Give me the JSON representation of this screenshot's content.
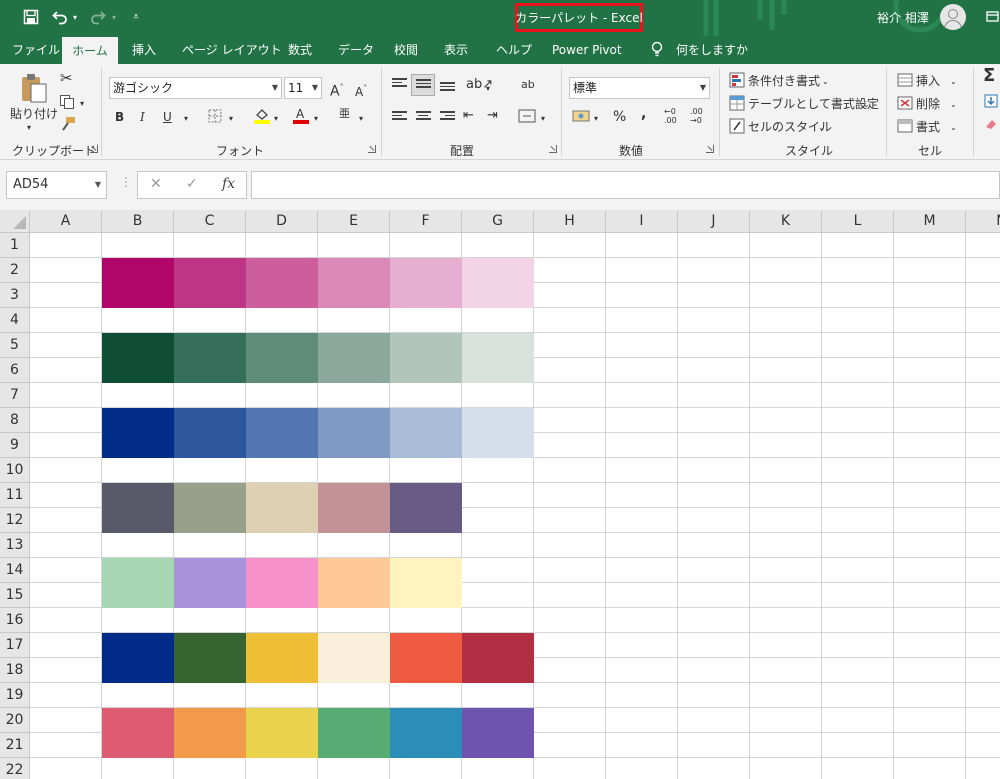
{
  "window": {
    "title": "カラーパレット  -  Excel",
    "user": "裕介 相澤"
  },
  "tabs": [
    "ファイル",
    "ホーム",
    "挿入",
    "ページ レイアウト",
    "数式",
    "データ",
    "校閲",
    "表示",
    "ヘルプ",
    "Power Pivot",
    "何をしますか"
  ],
  "active_tab": "ホーム",
  "ribbon": {
    "clipboard": {
      "paste_label": "貼り付け",
      "group_label": "クリップボード"
    },
    "font": {
      "font_name": "游ゴシック",
      "font_size": "11",
      "group_label": "フォント",
      "bold": "B",
      "italic": "I",
      "underline": "U"
    },
    "alignment": {
      "group_label": "配置"
    },
    "number": {
      "format": "標準",
      "percent": "%",
      "comma": ",",
      "group_label": "数値"
    },
    "styles": {
      "conditional": "条件付き書式",
      "table": "テーブルとして書式設定",
      "cell_styles": "セルのスタイル",
      "group_label": "スタイル"
    },
    "cells": {
      "insert": "挿入",
      "delete": "削除",
      "format": "書式",
      "group_label": "セル"
    }
  },
  "formula_bar": {
    "name_box": "AD54",
    "fx": "fx",
    "formula": ""
  },
  "columns": [
    "A",
    "B",
    "C",
    "D",
    "E",
    "F",
    "G",
    "H",
    "I",
    "J",
    "K",
    "L",
    "M",
    "N"
  ],
  "rows": [
    "1",
    "2",
    "3",
    "4",
    "5",
    "6",
    "7",
    "8",
    "9",
    "10",
    "11",
    "12",
    "13",
    "14",
    "15",
    "16",
    "17",
    "18",
    "19",
    "20",
    "21",
    "22"
  ],
  "palettes": [
    {
      "rows": [
        2,
        3
      ],
      "colors": [
        "#b0066a",
        "#bf3585",
        "#cc5e9e",
        "#da89b9",
        "#e6aed0",
        "#f3d3e6"
      ]
    },
    {
      "rows": [
        5,
        6
      ],
      "colors": [
        "#0f4d36",
        "#356f5c",
        "#5f8b7b",
        "#8aa99c",
        "#b1c5bc",
        "#d9e1dd"
      ]
    },
    {
      "rows": [
        8,
        9
      ],
      "colors": [
        "#032e87",
        "#2c579d",
        "#5276b0",
        "#7f99c4",
        "#a9bbd7",
        "#d6deeb"
      ]
    },
    {
      "rows": [
        11,
        12
      ],
      "colors": [
        "#595a69",
        "#98a089",
        "#e0d0b3",
        "#c39198",
        "#685c86"
      ]
    },
    {
      "rows": [
        14,
        15
      ],
      "colors": [
        "#a7d7b2",
        "#a993da",
        "#f691cc",
        "#ffc897",
        "#fff4bf"
      ]
    },
    {
      "rows": [
        17,
        18
      ],
      "colors": [
        "#002b88",
        "#386432",
        "#f0bf38",
        "#faefda",
        "#ee5941",
        "#b22e42"
      ]
    },
    {
      "rows": [
        20,
        21
      ],
      "colors": [
        "#de5c72",
        "#f19a4a",
        "#e9d24c",
        "#56ac72",
        "#2b8eb9",
        "#6e54af"
      ]
    }
  ],
  "accent_color": "#217346"
}
